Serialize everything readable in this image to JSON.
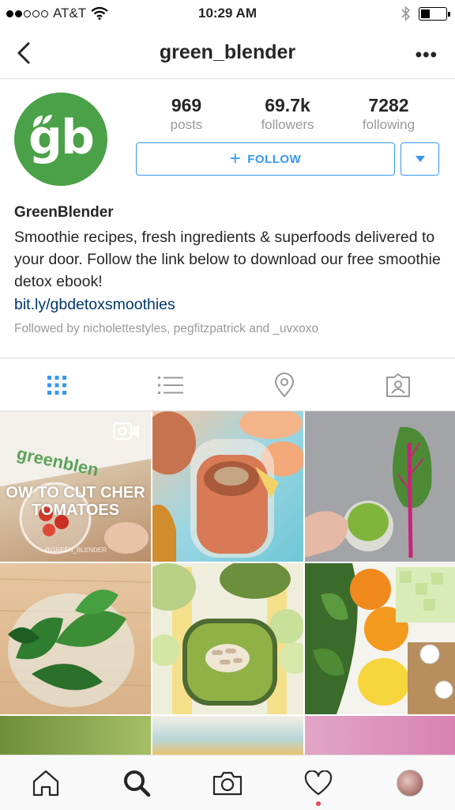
{
  "status_bar": {
    "carrier": "AT&T",
    "time": "10:29 AM",
    "signal_bars": 2,
    "battery_level": 0.35
  },
  "nav": {
    "username": "green_blender",
    "more_label": "•••"
  },
  "profile": {
    "avatar_text": "gb",
    "stats": [
      {
        "value": "969",
        "label": "posts"
      },
      {
        "value": "69.7k",
        "label": "followers"
      },
      {
        "value": "7282",
        "label": "following"
      }
    ],
    "follow_label": "FOLLOW",
    "follow_icon": "+",
    "display_name": "GreenBlender",
    "bio": "Smoothie recipes, fresh ingredients & superfoods delivered to your door. Follow the link below to download our free smoothie detox ebook!",
    "link": "bit.ly/gbdetoxsmoothies",
    "followed_by": "Followed by nicholettestyles, pegfitzpatrick and _uvxoxo"
  },
  "tabs": [
    {
      "name": "grid-view-icon",
      "active": true
    },
    {
      "name": "list-view-icon",
      "active": false
    },
    {
      "name": "location-pin-icon",
      "active": false
    },
    {
      "name": "tagged-photos-icon",
      "active": false
    }
  ],
  "grid": {
    "tiles": [
      {
        "caption": "OW TO CUT CHER\nTOMATOES",
        "sub": "@GREEN_BLENDER",
        "is_video": true
      },
      {
        "caption": "",
        "is_video": false
      },
      {
        "caption": "",
        "is_video": false
      },
      {
        "caption": "",
        "is_video": false
      },
      {
        "caption": "",
        "is_video": false
      },
      {
        "caption": "",
        "is_video": false
      }
    ]
  },
  "bottom_nav": [
    {
      "name": "home-icon"
    },
    {
      "name": "search-icon",
      "active": true
    },
    {
      "name": "camera-icon"
    },
    {
      "name": "heart-icon",
      "has_notification": true
    },
    {
      "name": "profile-avatar"
    }
  ],
  "colors": {
    "accent": "#3897f0",
    "brand_green": "#4aa147",
    "link": "#003569",
    "muted": "#999999",
    "notification": "#ed4956"
  }
}
